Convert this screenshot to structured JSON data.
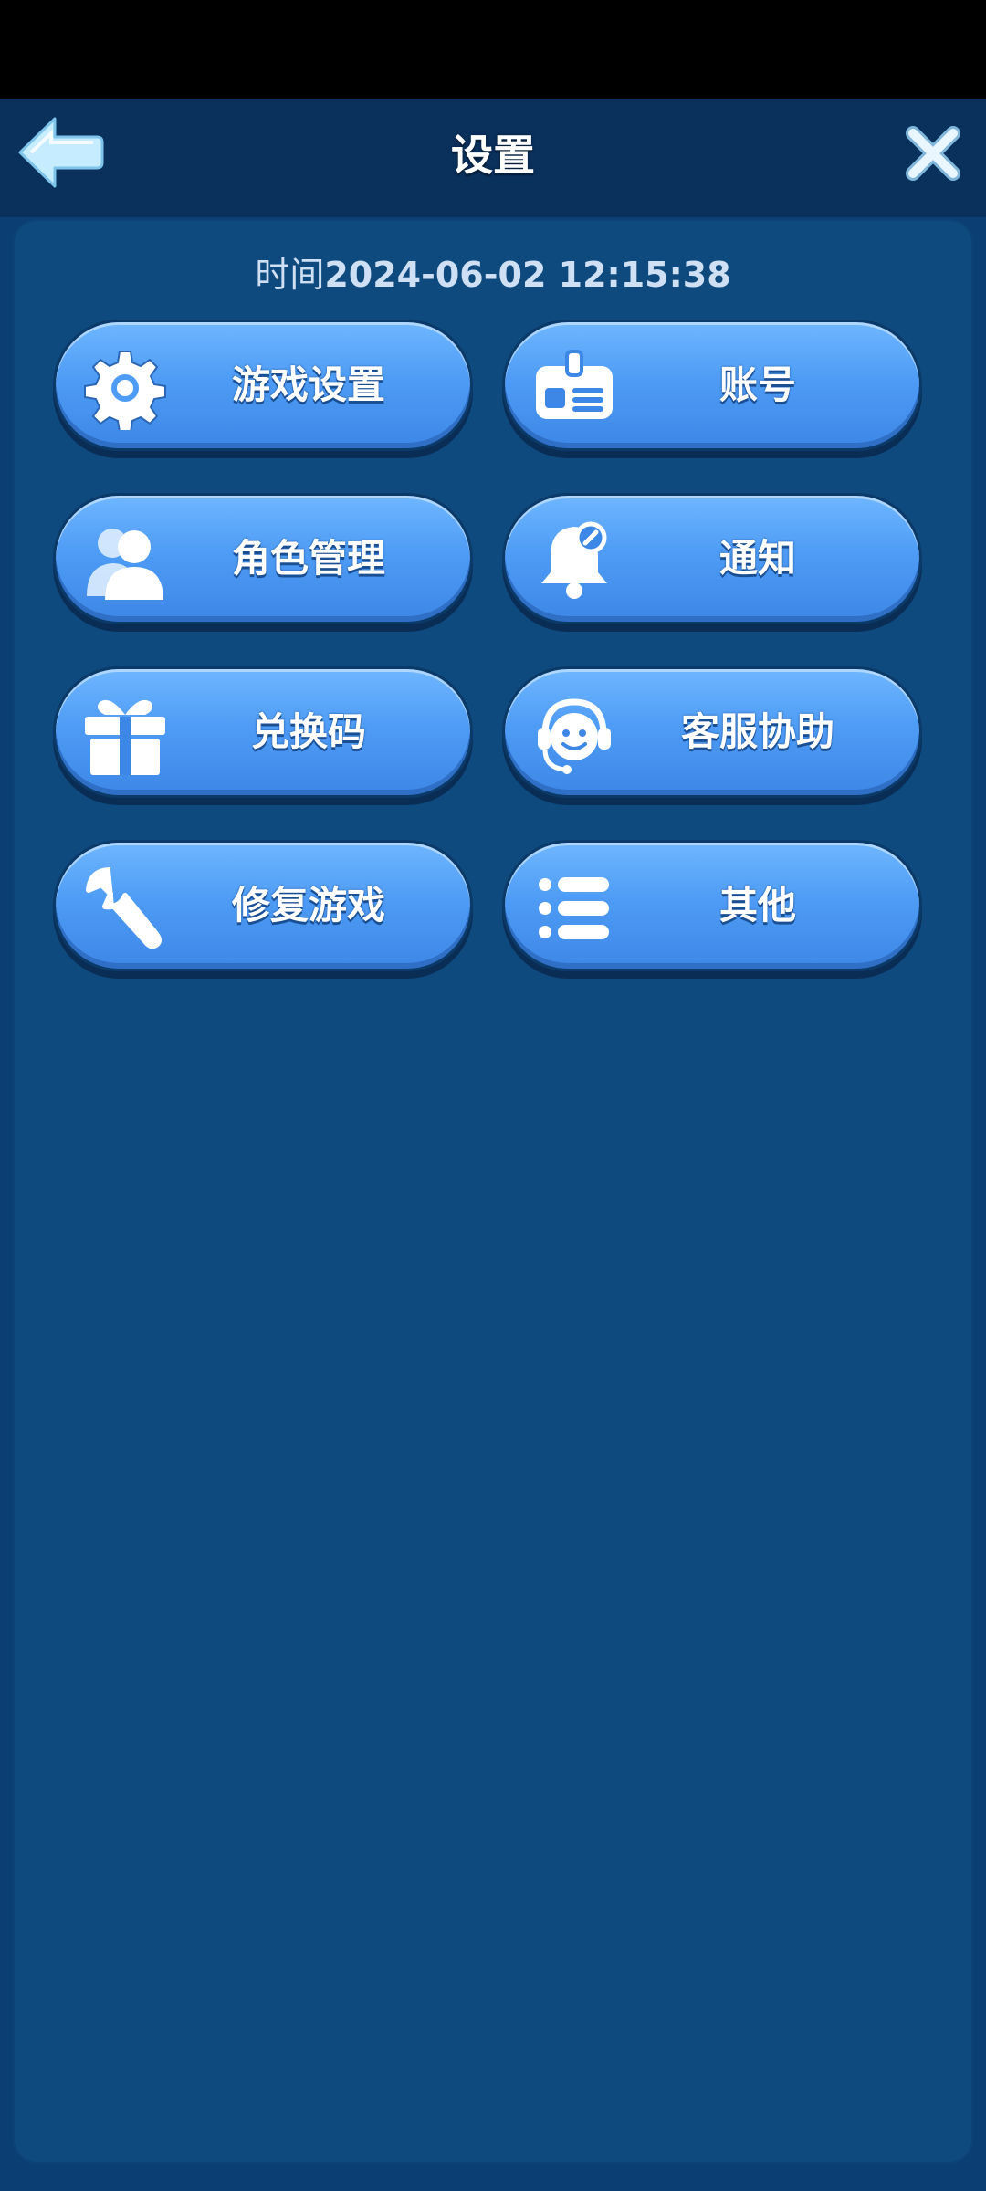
{
  "header": {
    "title": "设置",
    "back_icon": "back-arrow-icon",
    "close_icon": "close-icon"
  },
  "panel": {
    "timestamp_prefix": "时间",
    "timestamp_value": "2024-06-02 12:15:38"
  },
  "menu": {
    "items": [
      {
        "label": "游戏设置",
        "icon": "gear-icon"
      },
      {
        "label": "账号",
        "icon": "id-card-icon"
      },
      {
        "label": "角色管理",
        "icon": "users-icon"
      },
      {
        "label": "通知",
        "icon": "bell-icon"
      },
      {
        "label": "兑换码",
        "icon": "gift-icon"
      },
      {
        "label": "客服协助",
        "icon": "headset-icon"
      },
      {
        "label": "修复游戏",
        "icon": "wrench-icon"
      },
      {
        "label": "其他",
        "icon": "list-icon"
      }
    ]
  },
  "colors": {
    "background": "#0b3e72",
    "header": "#0a305c",
    "panel": "#0e4a7e",
    "button": "#4e9cf5",
    "accent_arrow": "#bfe8ff"
  }
}
